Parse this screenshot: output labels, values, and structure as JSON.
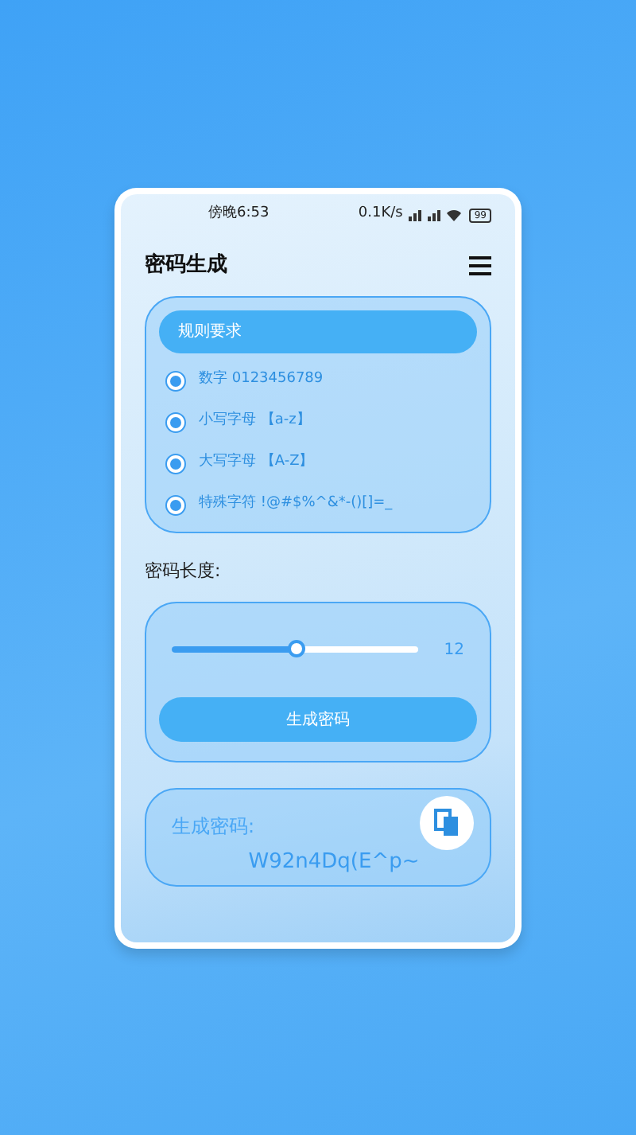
{
  "status_bar": {
    "time": "傍晚6:53",
    "speed": "0.1K/s",
    "battery": "99"
  },
  "app_bar": {
    "title": "密码生成"
  },
  "rules": {
    "title": "规则要求",
    "options": [
      {
        "label": "数字  0123456789",
        "checked": true
      },
      {
        "label": "小写字母 【a-z】",
        "checked": true
      },
      {
        "label": "大写字母 【A-Z】",
        "checked": true
      },
      {
        "label": "特殊字符 !@#$%^&*-()[]=_",
        "checked": true
      }
    ]
  },
  "length": {
    "label": "密码长度:",
    "level": 0.5,
    "reading": "12",
    "button": "生成密码"
  },
  "result": {
    "label": "生成密码:",
    "value": "W92n4Dq(E^p~"
  }
}
